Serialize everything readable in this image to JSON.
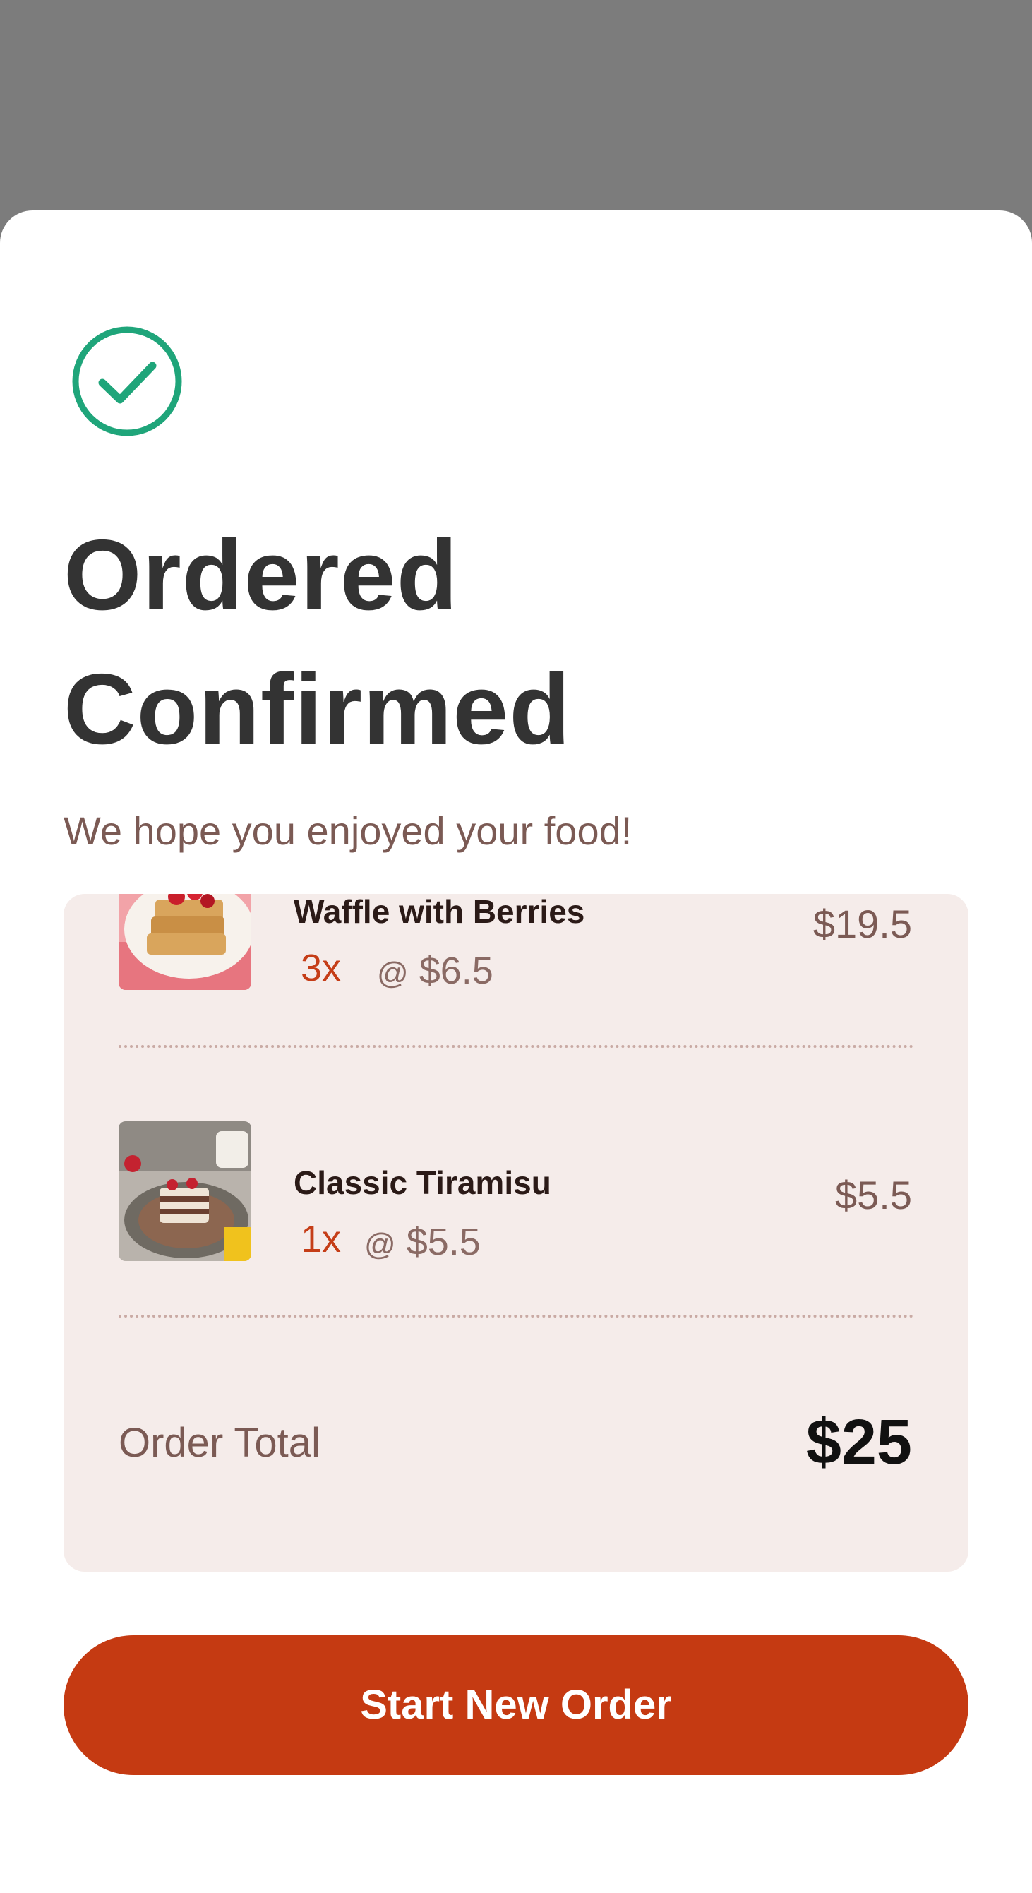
{
  "header": {
    "title": "Ordered Confirmed",
    "subtitle": "We hope you enjoyed your food!",
    "status_icon": "check-circle-icon",
    "status_color": "#1fa57a"
  },
  "order": {
    "items": [
      {
        "name": "Waffle with Berries",
        "quantity": "3x",
        "unit_price_prefix": "@",
        "unit_price": "$6.5",
        "line_total": "$19.5"
      },
      {
        "name": "Classic Tiramisu",
        "quantity": "1x",
        "unit_price_prefix": "@",
        "unit_price": "$5.5",
        "line_total": "$5.5"
      }
    ],
    "total_label": "Order Total",
    "total_value": "$25"
  },
  "actions": {
    "start_new_order": "Start New Order"
  },
  "colors": {
    "accent": "#c53a12",
    "card_background": "#f5ecea",
    "success": "#1fa57a"
  }
}
